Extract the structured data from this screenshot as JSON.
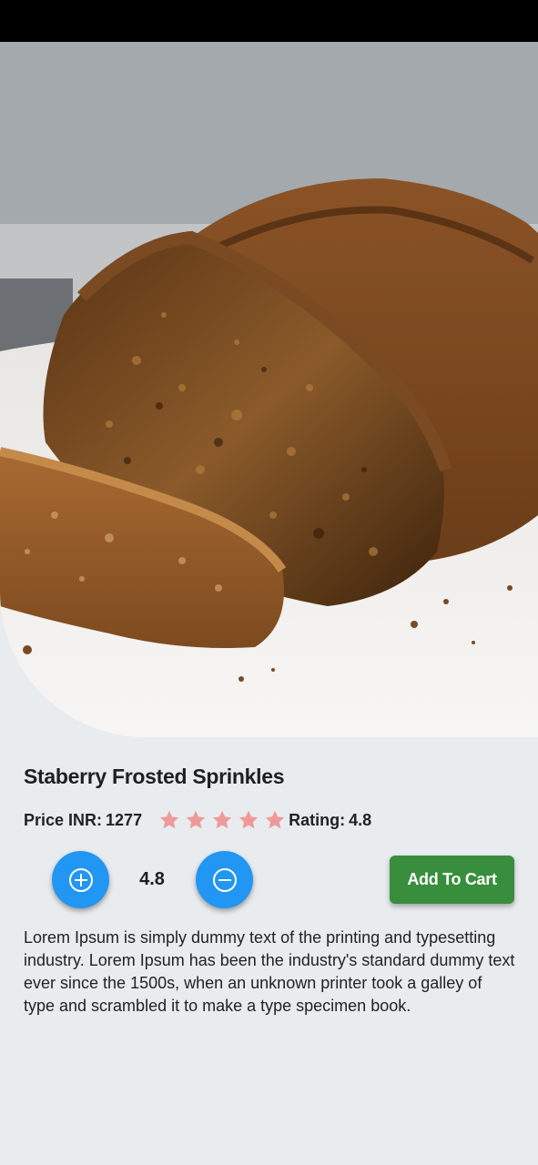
{
  "product": {
    "title": "Staberry Frosted Sprinkles",
    "price_label": "Price INR:",
    "price_value": "1277",
    "rating_label": "Rating:",
    "rating_value": "4.8",
    "rating_stars": 5,
    "quantity_display": "4.8",
    "description": "Lorem Ipsum is simply dummy text of the printing and typesetting industry. Lorem Ipsum has been the industry's standard dummy text ever since the 1500s, when an unknown printer took a galley of type and scrambled it to make a type specimen book."
  },
  "actions": {
    "add_to_cart_label": "Add To Cart"
  },
  "icons": {
    "increase": "plus-circle-icon",
    "decrease": "minus-circle-icon",
    "rating": "star-icon"
  },
  "colors": {
    "star": "#ef9a9a",
    "qty_button": "#2196f3",
    "add_to_cart": "#388e3c",
    "background": "#e9ecef"
  }
}
